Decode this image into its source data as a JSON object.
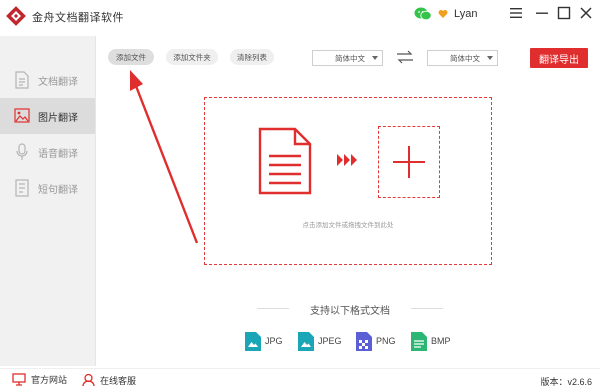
{
  "app": {
    "title": "金舟文档翻译软件",
    "user_name": "Lyan"
  },
  "sidebar": {
    "items": [
      {
        "label": "文档翻译",
        "icon": "document-icon",
        "active": false
      },
      {
        "label": "图片翻译",
        "icon": "image-icon",
        "active": true
      },
      {
        "label": "语音翻译",
        "icon": "microphone-icon",
        "active": false
      },
      {
        "label": "短句翻译",
        "icon": "sentence-icon",
        "active": false
      }
    ]
  },
  "toolbar": {
    "add_file": "添加文件",
    "add_folder": "添加文件夹",
    "clear_list": "清除列表",
    "source_lang": "简体中文",
    "target_lang": "简体中文",
    "translate_export": "翻译导出"
  },
  "dropzone": {
    "hint": "点击添加文件或拖拽文件到此处"
  },
  "formats": {
    "title": "支持以下格式文档",
    "items": [
      {
        "label": "JPG",
        "color": "#1aa6b7"
      },
      {
        "label": "JPEG",
        "color": "#1aa6b7"
      },
      {
        "label": "PNG",
        "color": "#5a5fd6"
      },
      {
        "label": "BMP",
        "color": "#2bb673"
      }
    ]
  },
  "statusbar": {
    "website": "官方网站",
    "support": "在线客服",
    "version": "版本：v2.6.6"
  },
  "colors": {
    "accent": "#e02e2e",
    "sidebar_bg": "#f1f1f1",
    "sidebar_active": "#dcdcdc"
  }
}
